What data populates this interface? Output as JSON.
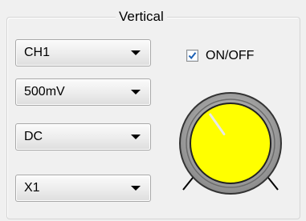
{
  "panel": {
    "title": "Vertical"
  },
  "channel_select": {
    "value": "CH1"
  },
  "volts_div_select": {
    "value": "500mV"
  },
  "coupling_select": {
    "value": "DC"
  },
  "probe_select": {
    "value": "X1"
  },
  "onoff_checkbox": {
    "label": "ON/OFF",
    "checked": true
  },
  "knob": {
    "fill_color": "#ffff00",
    "check_color": "#1a5fb4",
    "pointer_angle_deg": -35
  }
}
